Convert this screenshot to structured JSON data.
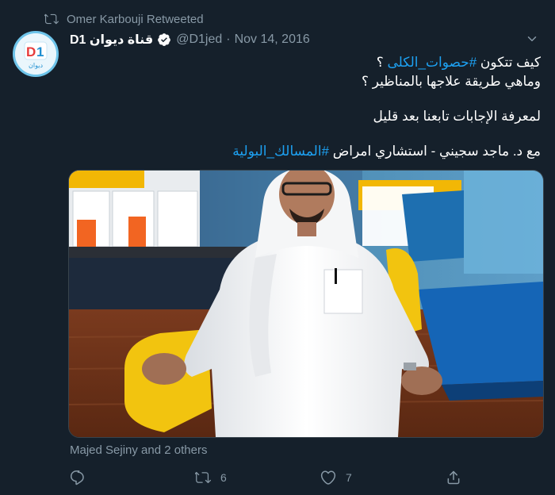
{
  "retweet": {
    "text": "Omer Karbouji Retweeted",
    "icon": "retweet-icon"
  },
  "author": {
    "display_name": "قناة ديوان D1",
    "handle": "@D1jed",
    "separator": "·",
    "date": "Nov 14, 2016",
    "verified": true,
    "avatar_label": "D1",
    "avatar_sub": "ديوان"
  },
  "tweet": {
    "line1_text": "كيف تتكون ",
    "line1_hashtag": "#حصوات_الكلى",
    "line1_suffix": " ؟",
    "line2": "وماهي طريقة علاجها بالمناظير ؟",
    "line3": "لمعرفة الإجابات تابعنا بعد قليل",
    "line4_text": "مع د. ماجد سجيني - استشاري امراض ",
    "line4_hashtag": "#المسالك_البولية"
  },
  "liked_by": "Majed Sejiny and 2 others",
  "actions": {
    "reply_count": "",
    "retweet_count": "6",
    "like_count": "7"
  },
  "colors": {
    "background": "#15202b",
    "secondary_text": "#8899a6",
    "accent": "#1da1f2"
  }
}
